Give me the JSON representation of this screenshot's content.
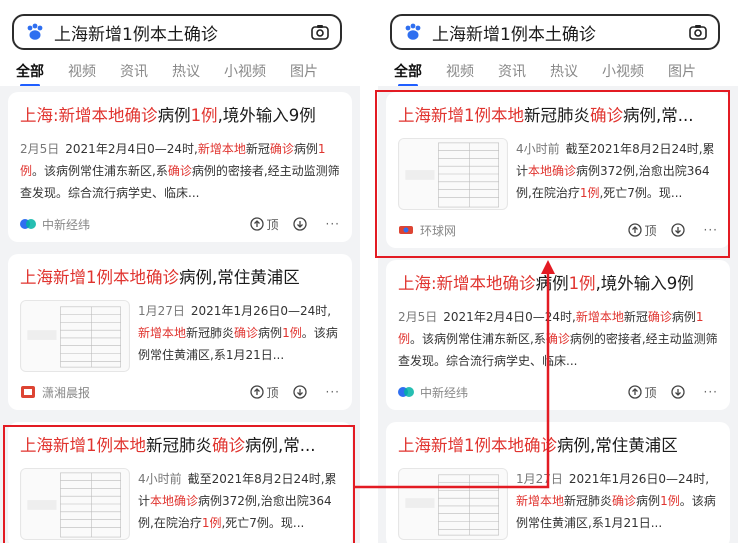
{
  "query": "上海新增1例本土确诊",
  "tabs": [
    "全部",
    "视频",
    "资讯",
    "热议",
    "小视频",
    "图片"
  ],
  "results": {
    "a": {
      "title_pre": "上海:新增本地确诊",
      "title_mid": "病例",
      "title_hl2": "1例",
      "title_post": ",境外输入9例",
      "date": "2月5日",
      "s1": "2021年2月4日0—24时,",
      "s2": "新增本地",
      "s3": "新冠",
      "s4": "确诊",
      "s5": "病例",
      "s6": "1例",
      "s7": "。该病例常住浦东新区,系",
      "s8": "确诊",
      "s9": "病例的密接者,经主动监测筛查发现。综合流行病学史、临床...",
      "source": "中新经纬",
      "up": "顶"
    },
    "b": {
      "title_pre": "上海新增1例本地确诊",
      "title_post": "病例,常住黄浦区",
      "date": "1月27日",
      "s1": "2021年1月26日0—24时,",
      "s2": "新增本地",
      "s3": "新冠肺炎",
      "s4": "确诊",
      "s5": "病例",
      "s6": "1例",
      "s7": "。该病例常住黄浦区,系1月21日...",
      "source": "潇湘晨报",
      "up": "顶"
    },
    "c": {
      "title_pre": "上海新增1例本地",
      "title_mid": "新冠肺炎",
      "title_hl2": "确诊",
      "title_post": "病例,常...",
      "date": "4小时前",
      "s1": "截至2021年8月2日24时,累计",
      "s2": "本地确诊",
      "s3": "病例372例,治愈出院364例,在院治疗",
      "s4": "1例",
      "s5": ",死亡7例。现...",
      "source": "环球网",
      "up": "顶"
    }
  },
  "colors": {
    "accent_red": "#e0342f",
    "tab_underline": "#1f5eff",
    "annotation_red": "#e31b23"
  }
}
